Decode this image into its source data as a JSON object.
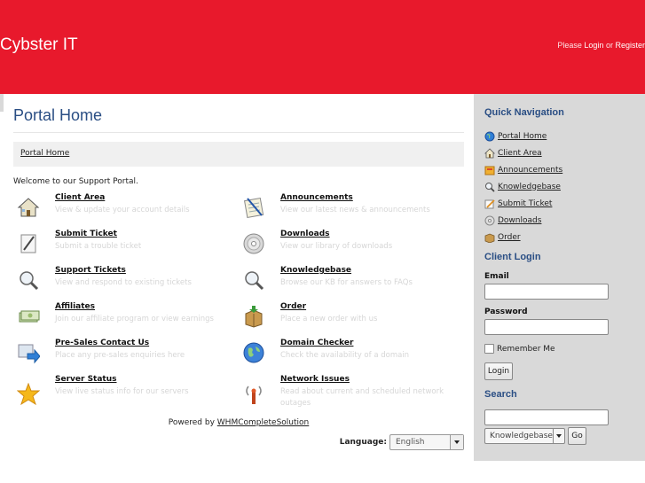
{
  "header": {
    "brand": "Cybster IT",
    "please_text": "Please",
    "login_label": "Login",
    "or_text": "or",
    "register_label": "Register",
    "bg_color": "#e8192c"
  },
  "main": {
    "page_title": "Portal Home",
    "breadcrumb": "Portal Home",
    "welcome": "Welcome to our Support Portal.",
    "items": [
      {
        "title": "Client Area",
        "desc": "View & update your account details",
        "icon": "house-icon"
      },
      {
        "title": "Announcements",
        "desc": "View our latest news & announcements",
        "icon": "notepad-icon"
      },
      {
        "title": "Submit Ticket",
        "desc": "Submit a trouble ticket",
        "icon": "pencil-paper-icon"
      },
      {
        "title": "Downloads",
        "desc": "View our library of downloads",
        "icon": "disc-icon"
      },
      {
        "title": "Support Tickets",
        "desc": "View and respond to existing tickets",
        "icon": "magnifier-icon"
      },
      {
        "title": "Knowledgebase",
        "desc": "Browse our KB for answers to FAQs",
        "icon": "magnifier-icon"
      },
      {
        "title": "Affiliates",
        "desc": "Join our affiliate program or view earnings",
        "icon": "money-icon"
      },
      {
        "title": "Order",
        "desc": "Place a new order with us",
        "icon": "box-icon"
      },
      {
        "title": "Pre-Sales Contact Us",
        "desc": "Place any pre-sales enquiries here",
        "icon": "arrow-right-icon"
      },
      {
        "title": "Domain Checker",
        "desc": "Check the availability of a domain",
        "icon": "globe-icon"
      },
      {
        "title": "Server Status",
        "desc": "View live status info for our servers",
        "icon": "star-icon"
      },
      {
        "title": "Network Issues",
        "desc": "Read about current and scheduled network outages",
        "icon": "antenna-icon"
      }
    ],
    "powered_prefix": "Powered by",
    "powered_link": "WHMCompleteSolution",
    "language_label": "Language:",
    "language_value": "English"
  },
  "sidebar": {
    "quick_nav_title": "Quick Navigation",
    "nav": [
      {
        "label": "Portal Home",
        "icon": "home-globe-icon"
      },
      {
        "label": "Client Area",
        "icon": "house-icon"
      },
      {
        "label": "Announcements",
        "icon": "megaphone-icon"
      },
      {
        "label": "Knowledgebase",
        "icon": "magnifier-icon"
      },
      {
        "label": "Submit Ticket",
        "icon": "pencil-icon"
      },
      {
        "label": "Downloads",
        "icon": "disc-icon"
      },
      {
        "label": "Order",
        "icon": "box-icon"
      }
    ],
    "client_login_title": "Client Login",
    "email_label": "Email",
    "password_label": "Password",
    "remember_label": "Remember Me",
    "login_button": "Login",
    "search_title": "Search",
    "search_scope": "Knowledgebase",
    "go_button": "Go"
  }
}
